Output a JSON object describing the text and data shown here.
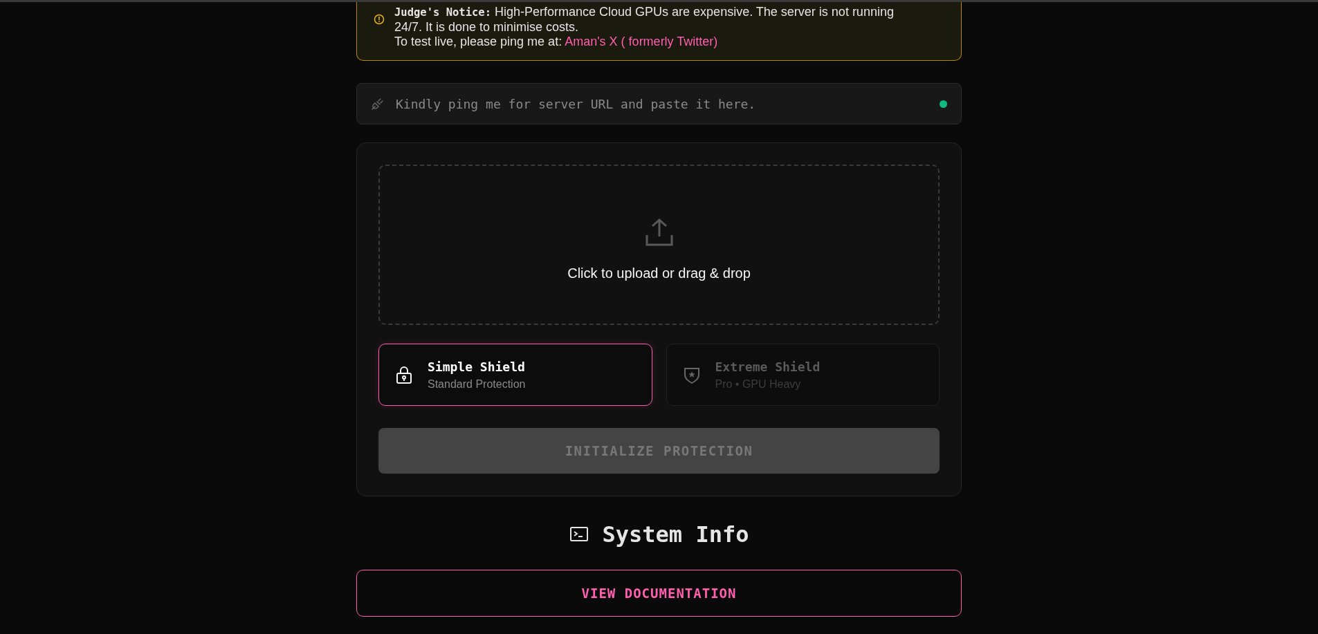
{
  "notice": {
    "title": "Judge's Notice:",
    "text": "High-Performance Cloud GPUs are expensive. The server is not running 24/7. It is done to minimise costs.",
    "prompt": "To test live, please ping me at:",
    "link": "Aman's X ( formerly Twitter)"
  },
  "server_field": {
    "placeholder": "Kindly ping me for server URL and paste it here.",
    "connected": true
  },
  "upload": {
    "label": "Click to upload or drag & drop"
  },
  "modes": [
    {
      "kind": "lock",
      "title": "Simple Shield",
      "subtitle": "Standard Protection",
      "selected": true
    },
    {
      "kind": "shield",
      "title": "Extreme Shield",
      "subtitle": "Pro • GPU Heavy",
      "selected": false
    }
  ],
  "submit": {
    "label": "INITIALIZE PROTECTION",
    "disabled": true
  },
  "section": {
    "title": "System Info"
  },
  "docs_button": {
    "label": "VIEW DOCUMENTATION"
  }
}
